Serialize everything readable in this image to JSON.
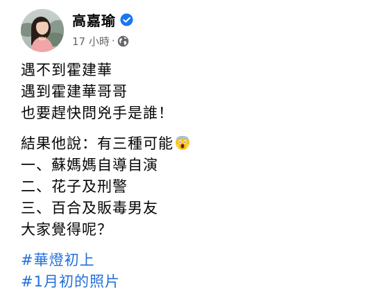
{
  "post": {
    "author": "高嘉瑜",
    "time": "17 小時",
    "separator": "·",
    "icons": {
      "verified": "verified-badge-icon",
      "audience": "globe-public-icon",
      "emoji": "face-screaming-in-fear-emoji"
    },
    "paragraph1": [
      "遇不到霍建華",
      "遇到霍建華哥哥",
      "也要趕快問兇手是誰！"
    ],
    "paragraph2": [
      "結果他說：有三種可能",
      "一、蘇媽媽自導自演",
      "二、花子及刑警",
      "三、百合及販毒男友",
      "大家覺得呢？"
    ],
    "hashtags": [
      "#華燈初上",
      "#1月初的照片"
    ]
  },
  "colors": {
    "text": "#050505",
    "secondary_text": "#65676b",
    "link": "#216fdb",
    "verified_badge": "#1877f2"
  }
}
